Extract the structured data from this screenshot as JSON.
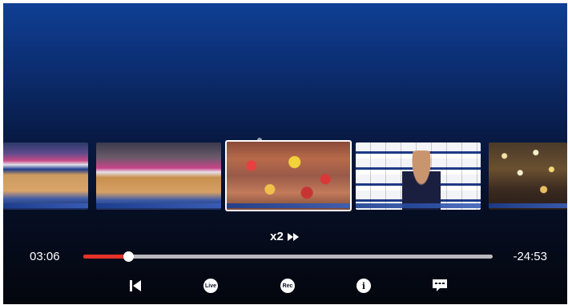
{
  "playback": {
    "speed_label": "x2",
    "elapsed": "03:06",
    "remaining": "-24:53",
    "progress_fraction": 0.11
  },
  "thumbnails": [
    {
      "name": "thumbnail-court-wide"
    },
    {
      "name": "thumbnail-court-action"
    },
    {
      "name": "thumbnail-crowd-celebration"
    },
    {
      "name": "thumbnail-player-interview"
    },
    {
      "name": "thumbnail-trophy-celebration"
    }
  ],
  "controls": {
    "live_label": "Live",
    "rec_label": "Rec",
    "info_label": "i"
  },
  "colors": {
    "progress_accent": "#e53127",
    "background_top": "#0f3f94",
    "background_bottom": "#04060d"
  },
  "icons": [
    "skip-back-icon",
    "live-icon",
    "rec-icon",
    "info-icon",
    "subtitles-icon",
    "fast-forward-icon"
  ]
}
